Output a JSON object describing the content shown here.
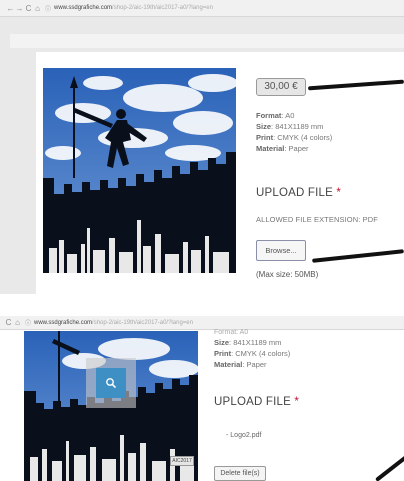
{
  "top_browser": {
    "host": "www.ssdgrafiche.com",
    "path": "/shop-2/aic-19th/aic2017-a0/?lang=en"
  },
  "bottom_browser": {
    "host": "www.ssdgrafiche.com",
    "path": "/shop-2/aic-19th/aic2017-a0/?lang=en"
  },
  "product": {
    "price": "30,00 €",
    "specs": [
      {
        "label": "Format",
        "value": "A0"
      },
      {
        "label": "Size",
        "value": "841X1189 mm"
      },
      {
        "label": "Print",
        "value": "CMYK (4 colors)"
      },
      {
        "label": "Material",
        "value": "Paper"
      }
    ],
    "upload_title": "UPLOAD FILE",
    "required_mark": "*",
    "allowed_ext": "ALLOWED FILE EXTENSION: PDF",
    "browse_label": "Browse...",
    "max_size": "(Max size: 50MB)"
  },
  "bottom_view": {
    "specs_partial_top": "Format: A0",
    "specs": [
      {
        "label": "Size",
        "value": "841X1189 mm"
      },
      {
        "label": "Print",
        "value": "CMYK (4 colors)"
      },
      {
        "label": "Material",
        "value": "Paper"
      }
    ],
    "upload_title": "UPLOAD FILE",
    "required_mark": "*",
    "file_name": "Logo2.pdf",
    "delete_label": "Delete file(s)",
    "image_tag": "AIC2017"
  },
  "icons": {
    "back": "←",
    "forward": "→",
    "reload": "C",
    "home": "⌂",
    "zoom": "magnifier-icon"
  },
  "colors": {
    "required": "#c8102e",
    "zoom_button": "#3d8fc4"
  }
}
